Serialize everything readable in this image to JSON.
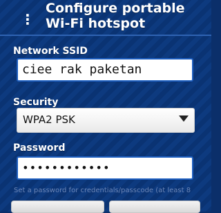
{
  "dialog": {
    "title": "Configure portable Wi-Fi hotspot",
    "title_icon": "info-icon"
  },
  "fields": {
    "ssid_label": "Network SSID",
    "ssid_value": "ciee rak paketan",
    "security_label": "Security",
    "security_value": "WPA2 PSK",
    "password_label": "Password",
    "password_value": "••••••••••••"
  },
  "hint": "Set a password for credentials/passcode (at least 8",
  "buttons": {
    "left_label": "",
    "right_label": ""
  }
}
